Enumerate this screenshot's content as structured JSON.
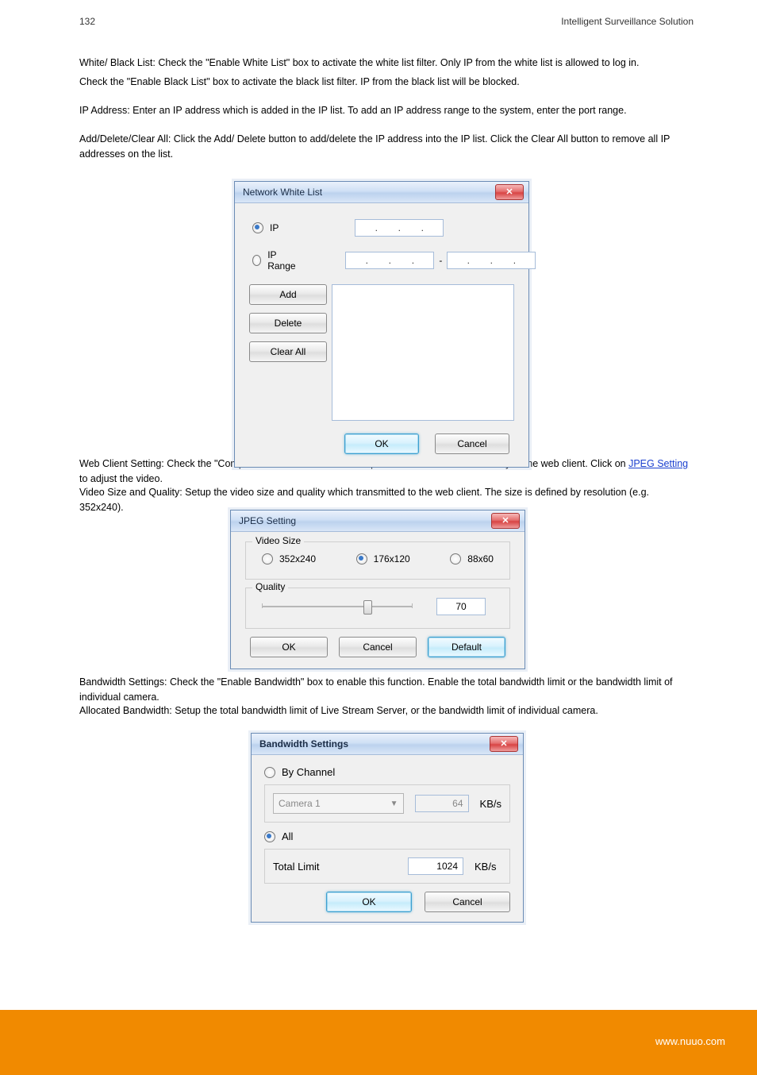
{
  "doc": {
    "page_no": "132",
    "title": "Intelligent Surveillance Solution",
    "url": "www.nuuo.com"
  },
  "text": {
    "t1": "White/ Black List: Check the \"Enable White List\" box to activate the white list filter. Only IP from the white list is allowed to log in.",
    "t2": "Check the \"Enable Black List\" box to activate the black list filter. IP from the black list will be blocked.",
    "t3": "IP Address: Enter an IP address which is added in the IP list. To add an IP address range to the system, enter the port range.",
    "t4": "Add/Delete/Clear All: Click the Add/ Delete button to add/delete the IP address into the IP list. Click the Clear All button to remove all IP addresses on the list.",
    "t5_a": "Web Client Setting: Check the \"Compress video to JPEG\" box to optimize the bandwidth efficiency of the web client. Click on ",
    "t5_link": "JPEG Setting",
    "t5_b": " to adjust the video.",
    "t6": "Video Size and Quality: Setup the video size and quality which transmitted to the web client. The size is defined by resolution (e.g. 352x240).",
    "t7": "Bandwidth Settings: Check the \"Enable Bandwidth\" box to enable this function. Enable the total bandwidth limit or the bandwidth limit of individual camera.",
    "t8": "Allocated Bandwidth: Setup the total bandwidth limit of Live Stream Server, or the bandwidth limit of individual camera."
  },
  "dlg1": {
    "title": "Network White List",
    "ip_label": "IP",
    "iprange_label": "IP Range",
    "btn_add": "Add",
    "btn_del": "Delete",
    "btn_clr": "Clear All",
    "btn_ok": "OK",
    "btn_cancel": "Cancel"
  },
  "dlg2": {
    "title": "JPEG Setting",
    "fs_size": "Video Size",
    "fs_quality": "Quality",
    "opt1": "352x240",
    "opt2": "176x120",
    "opt3": "88x60",
    "quality_value": "70",
    "btn_ok": "OK",
    "btn_cancel": "Cancel",
    "btn_default": "Default"
  },
  "dlg3": {
    "title": "Bandwidth Settings",
    "opt_bychannel": "By Channel",
    "opt_all": "All",
    "camera": "Camera 1",
    "per_value": "64",
    "per_unit": "KB/s",
    "total_label": "Total Limit",
    "total_value": "1024",
    "total_unit": "KB/s",
    "btn_ok": "OK",
    "btn_cancel": "Cancel"
  }
}
